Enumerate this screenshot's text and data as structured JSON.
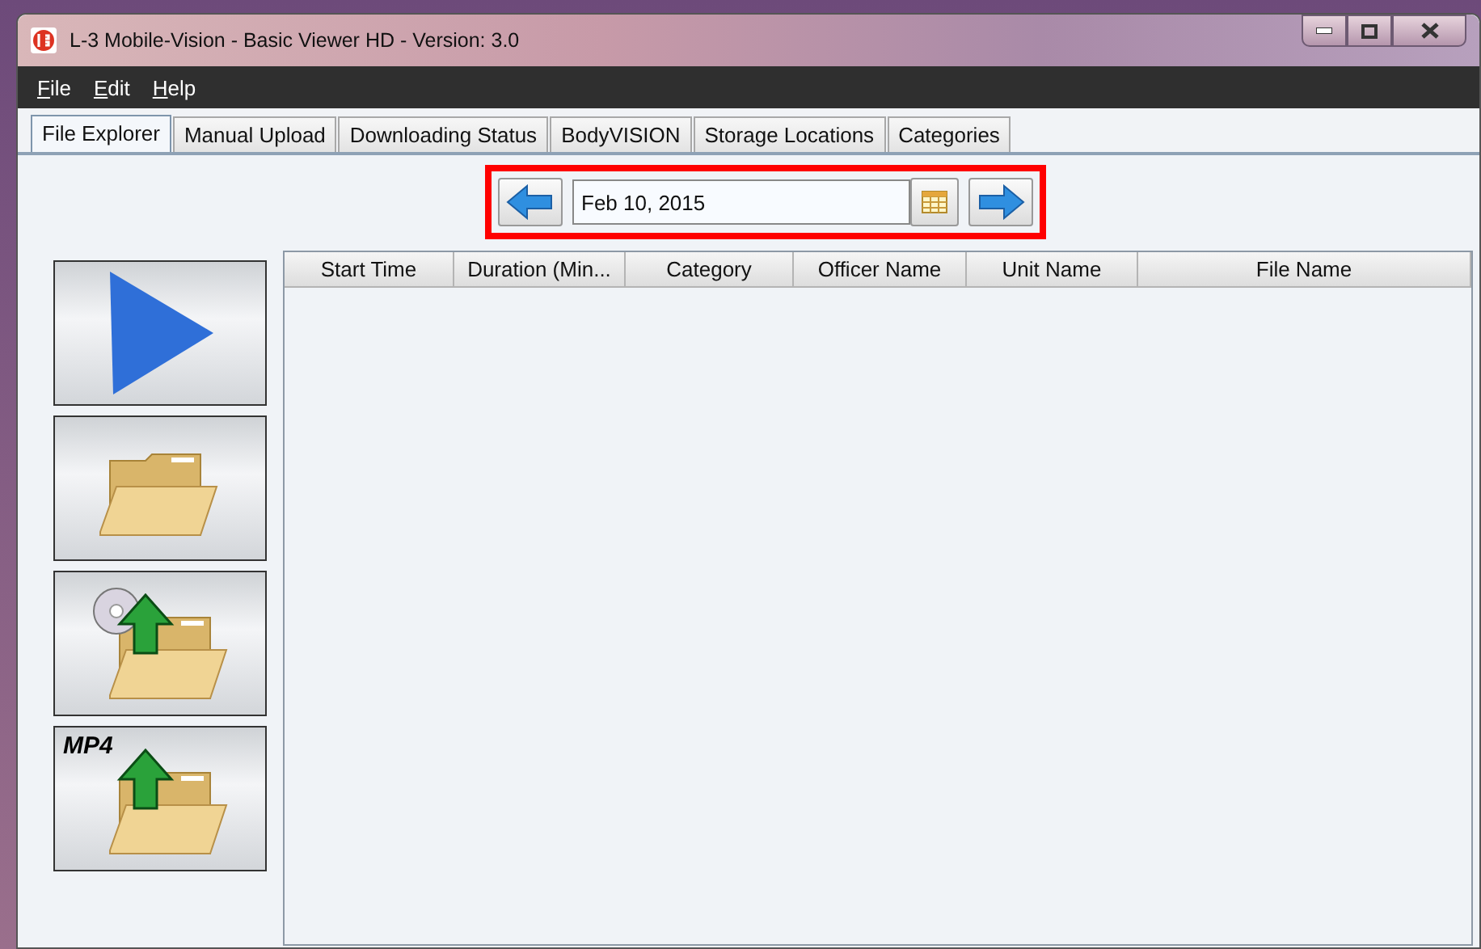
{
  "window": {
    "title": "L-3 Mobile-Vision - Basic Viewer HD - Version: 3.0"
  },
  "menu": [
    {
      "label": "File"
    },
    {
      "label": "Edit"
    },
    {
      "label": "Help"
    }
  ],
  "tabs": [
    {
      "label": "File Explorer",
      "selected": true
    },
    {
      "label": "Manual Upload",
      "selected": false
    },
    {
      "label": "Downloading Status",
      "selected": false
    },
    {
      "label": "BodyVISION",
      "selected": false
    },
    {
      "label": "Storage Locations",
      "selected": false
    },
    {
      "label": "Categories",
      "selected": false
    }
  ],
  "date_nav": {
    "value": "Feb 10, 2015",
    "highlighted": true
  },
  "tool_buttons": [
    {
      "kind": "play"
    },
    {
      "kind": "folder"
    },
    {
      "kind": "disc-upload"
    },
    {
      "kind": "mp4-upload",
      "label": "MP4"
    }
  ],
  "table": {
    "columns": [
      "Start Time",
      "Duration (Min...",
      "Category",
      "Officer Name",
      "Unit Name",
      "File Name"
    ]
  }
}
